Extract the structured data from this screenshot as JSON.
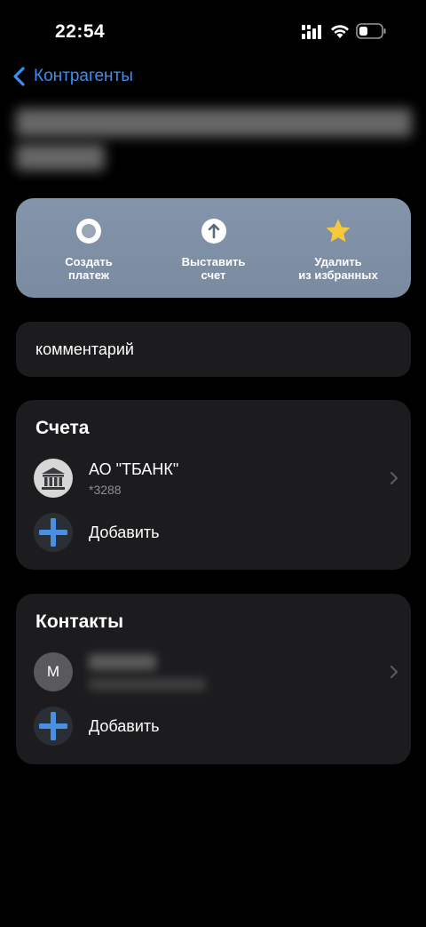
{
  "status_bar": {
    "time": "22:54"
  },
  "nav": {
    "back_label": "Контрагенты"
  },
  "actions": [
    {
      "label": "Создать\nплатеж",
      "icon": "circle-icon"
    },
    {
      "label": "Выставить\nсчет",
      "icon": "arrow-up-circle-icon"
    },
    {
      "label": "Удалить\nиз избранных",
      "icon": "star-icon"
    }
  ],
  "comment": {
    "text": "комментарий"
  },
  "accounts": {
    "title": "Счета",
    "items": [
      {
        "name": "АО \"ТБАНК\"",
        "number": "*3288",
        "icon": "bank-icon"
      }
    ],
    "add_label": "Добавить"
  },
  "contacts": {
    "title": "Контакты",
    "items": [
      {
        "initial": "М"
      }
    ],
    "add_label": "Добавить"
  },
  "colors": {
    "accent": "#3d8ef7",
    "card": "#1c1c1e",
    "actions_card": "#8495ab",
    "star": "#f7c83a",
    "plus": "#4a90e2"
  }
}
